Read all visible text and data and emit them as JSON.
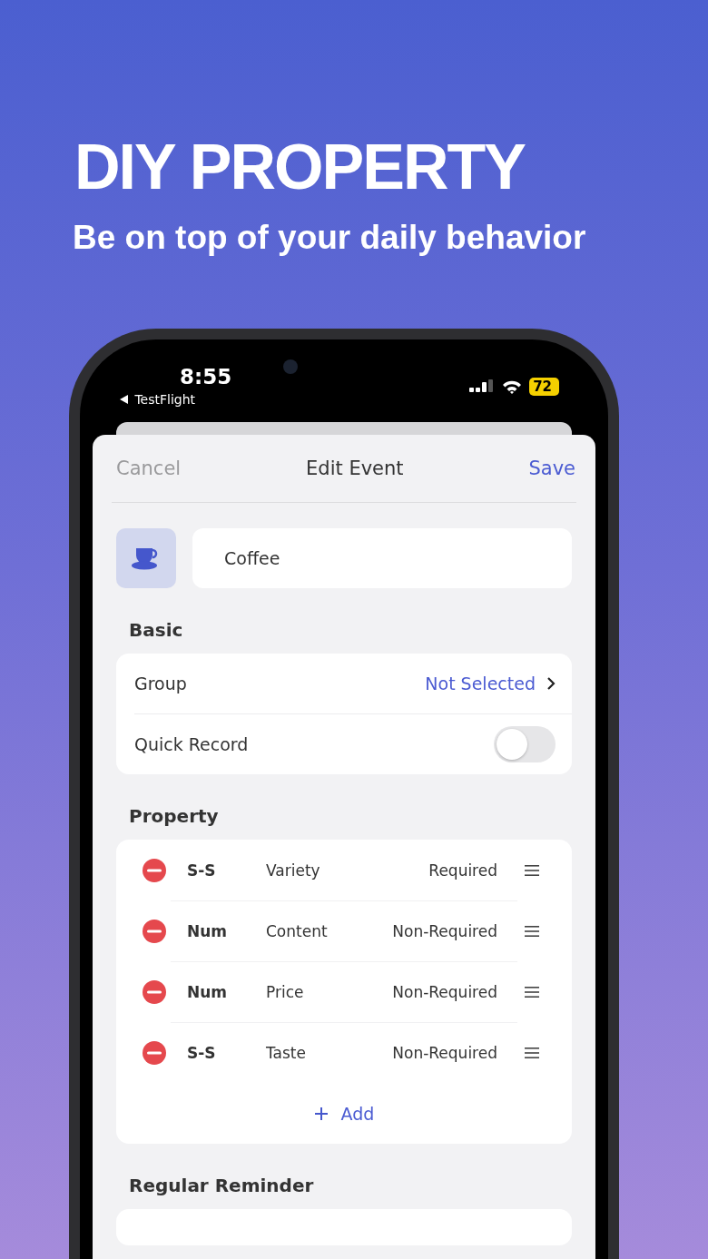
{
  "headline": "DIY PROPERTY",
  "subheadline": "Be on top of your daily behavior",
  "status_bar": {
    "time": "8:55",
    "back_app": "TestFlight",
    "battery": "72"
  },
  "nav": {
    "cancel": "Cancel",
    "title": "Edit Event",
    "save": "Save"
  },
  "event": {
    "name": "Coffee"
  },
  "basic": {
    "title": "Basic",
    "group_label": "Group",
    "group_value": "Not Selected",
    "quick_record": {
      "label": "Quick Record",
      "on": false
    }
  },
  "property": {
    "title": "Property",
    "add": "Add",
    "rows": [
      {
        "type": "S-S",
        "name": "Variety",
        "requirement": "Required"
      },
      {
        "type": "Num",
        "name": "Content",
        "requirement": "Non-Required"
      },
      {
        "type": "Num",
        "name": "Price",
        "requirement": "Non-Required"
      },
      {
        "type": "S-S",
        "name": "Taste",
        "requirement": "Non-Required"
      }
    ]
  },
  "reminder": {
    "title": "Regular Reminder"
  }
}
